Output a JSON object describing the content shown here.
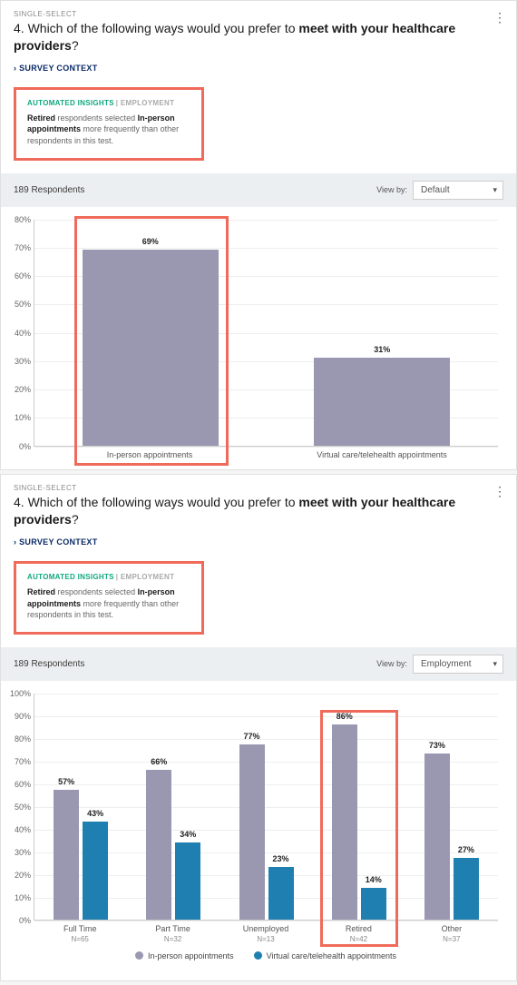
{
  "card1": {
    "type_tag": "SINGLE-SELECT",
    "question_prefix": "4. Which of the following ways would you prefer to ",
    "question_bold": "meet with your healthcare providers",
    "question_suffix": "?",
    "survey_context": "SURVEY CONTEXT",
    "insight_tag_left": "AUTOMATED INSIGHTS",
    "insight_tag_right": "| EMPLOYMENT",
    "insight_bold1": "Retired",
    "insight_mid1": " respondents selected ",
    "insight_bold2": "In-person appointments",
    "insight_mid2": " more frequently than other respondents in this test.",
    "respondents": "189 Respondents",
    "viewby_label": "View by:",
    "viewby_value": "Default"
  },
  "card2": {
    "type_tag": "SINGLE-SELECT",
    "question_prefix": "4. Which of the following ways would you prefer to ",
    "question_bold": "meet with your healthcare providers",
    "question_suffix": "?",
    "survey_context": "SURVEY CONTEXT",
    "insight_tag_left": "AUTOMATED INSIGHTS",
    "insight_tag_right": "| EMPLOYMENT",
    "insight_bold1": "Retired",
    "insight_mid1": " respondents selected ",
    "insight_bold2": "In-person appointments",
    "insight_mid2": " more frequently than other respondents in this test.",
    "respondents": "189 Respondents",
    "viewby_label": "View by:",
    "viewby_value": "Employment"
  },
  "legend": {
    "a": "In-person appointments",
    "b": "Virtual care/telehealth appointments"
  },
  "chart_data": [
    {
      "type": "bar",
      "title": "",
      "ylim": [
        0,
        80
      ],
      "yticks": [
        "0%",
        "10%",
        "20%",
        "30%",
        "40%",
        "50%",
        "60%",
        "70%",
        "80%"
      ],
      "categories": [
        "In-person appointments",
        "Virtual care/telehealth appointments"
      ],
      "values": [
        69,
        31
      ],
      "value_labels": [
        "69%",
        "31%"
      ]
    },
    {
      "type": "bar",
      "title": "",
      "ylim": [
        0,
        100
      ],
      "yticks": [
        "0%",
        "10%",
        "20%",
        "30%",
        "40%",
        "50%",
        "60%",
        "70%",
        "80%",
        "90%",
        "100%"
      ],
      "categories": [
        "Full Time",
        "Part Time",
        "Unemployed",
        "Retired",
        "Other"
      ],
      "category_n": [
        "N=65",
        "N=32",
        "N=13",
        "N=42",
        "N=37"
      ],
      "series": [
        {
          "name": "In-person appointments",
          "color": "#9a98b0",
          "values": [
            57,
            66,
            77,
            86,
            73
          ],
          "labels": [
            "57%",
            "66%",
            "77%",
            "86%",
            "73%"
          ]
        },
        {
          "name": "Virtual care/telehealth appointments",
          "color": "#1f7fb0",
          "values": [
            43,
            34,
            23,
            14,
            27
          ],
          "labels": [
            "43%",
            "34%",
            "23%",
            "14%",
            "27%"
          ]
        }
      ]
    }
  ]
}
